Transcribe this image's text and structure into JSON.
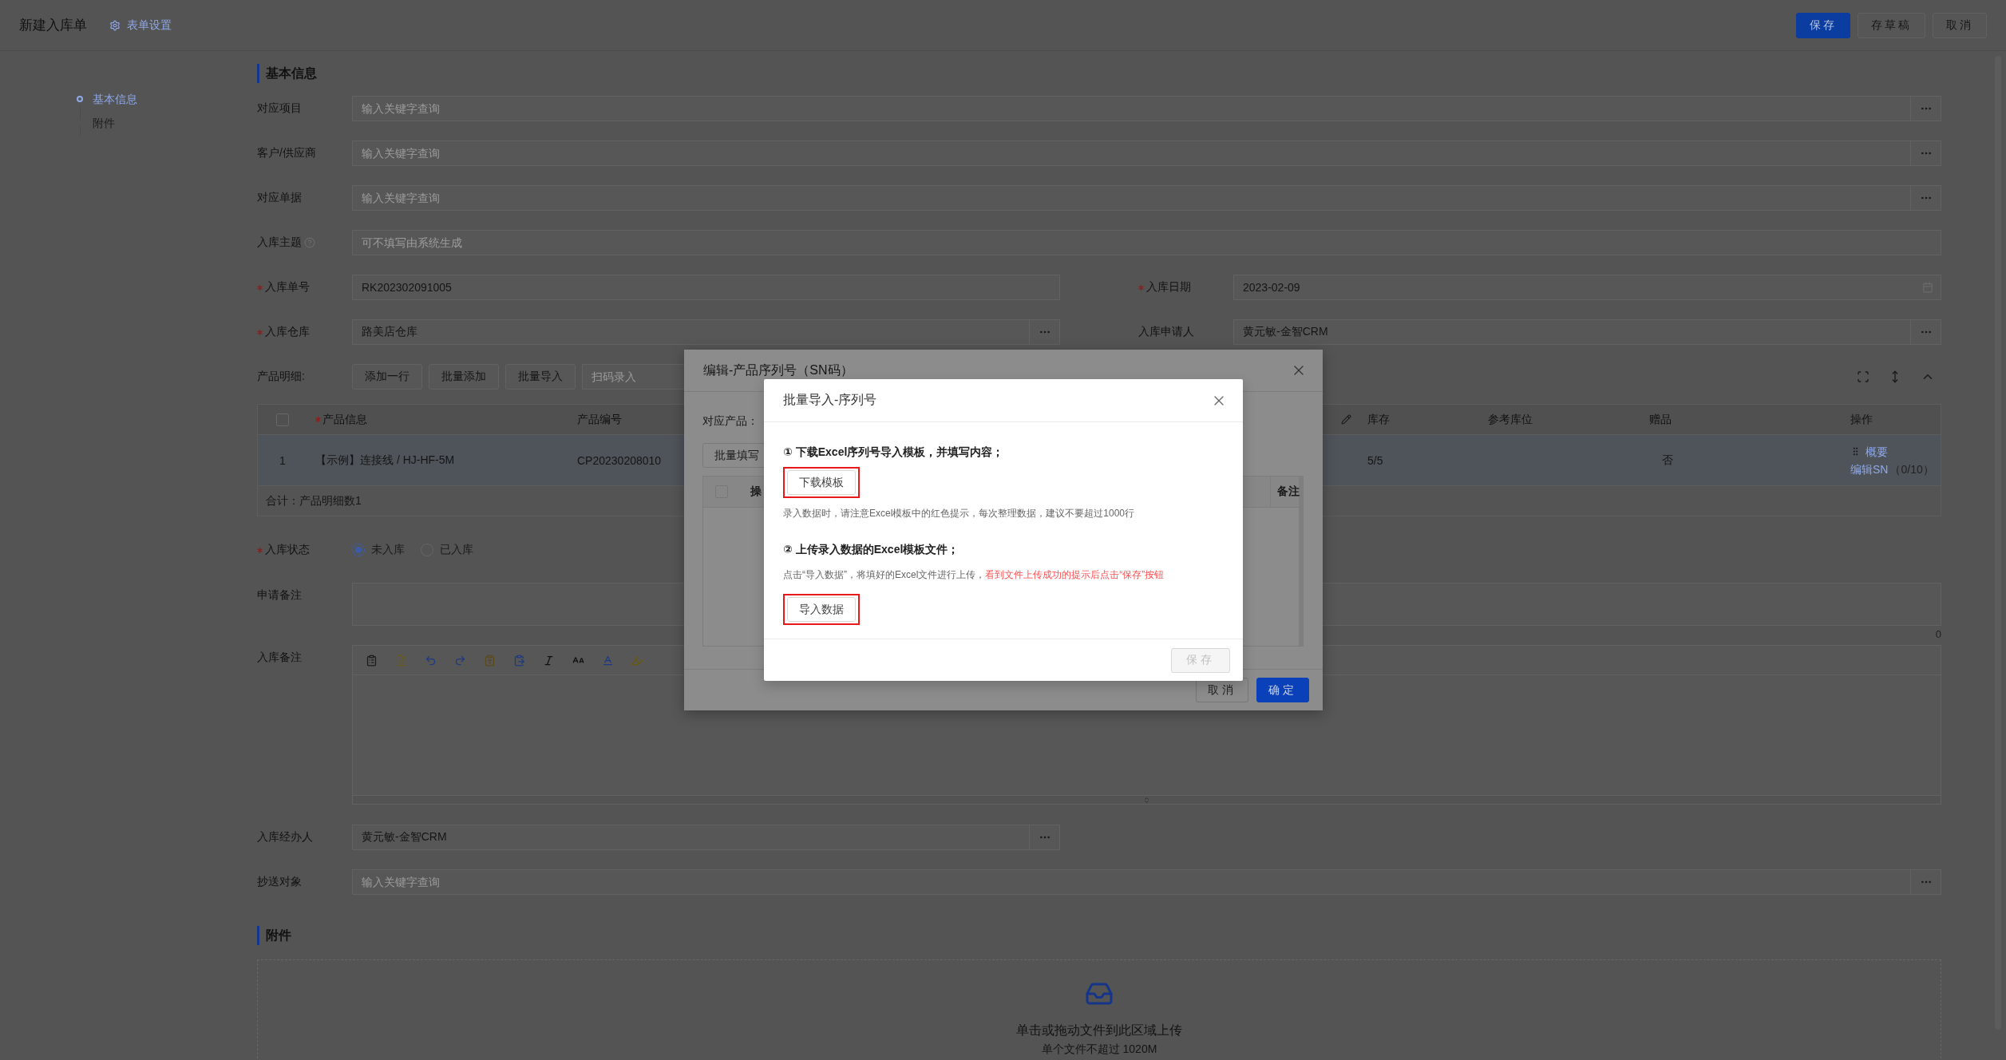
{
  "header": {
    "title": "新建入库单",
    "settings_link": "表单设置",
    "buttons": [
      {
        "label": "保存",
        "kind": "primary"
      },
      {
        "label": "存草稿",
        "kind": "default"
      },
      {
        "label": "取消",
        "kind": "default"
      }
    ]
  },
  "side_nav": [
    {
      "label": "基本信息",
      "selected": true
    },
    {
      "label": "附件",
      "selected": false
    }
  ],
  "basic_info": {
    "heading": "基本信息",
    "rows": [
      [
        {
          "label": "对应项目",
          "required": false,
          "help": false,
          "kind": "lookup",
          "placeholder": "输入关键字查询"
        }
      ],
      [
        {
          "label": "客户/供应商",
          "required": false,
          "help": false,
          "kind": "lookup",
          "placeholder": "输入关键字查询"
        }
      ],
      [
        {
          "label": "对应单据",
          "required": false,
          "help": false,
          "kind": "lookup",
          "placeholder": "输入关键字查询"
        }
      ],
      [
        {
          "label": "入库主题",
          "required": false,
          "help": true,
          "kind": "text",
          "placeholder": "可不填写由系统生成"
        }
      ],
      [
        {
          "label": "入库单号",
          "required": true,
          "help": false,
          "kind": "text",
          "value": "RK202302091005"
        },
        {
          "label": "入库日期",
          "required": true,
          "help": false,
          "kind": "date",
          "value": "2023-02-09"
        }
      ],
      [
        {
          "label": "入库仓库",
          "required": true,
          "help": false,
          "kind": "lookup",
          "value": "路美店仓库"
        },
        {
          "label": "入库申请人",
          "required": false,
          "help": false,
          "kind": "lookup",
          "value": "黄元敏-金智CRM"
        }
      ]
    ]
  },
  "products": {
    "label": "产品明细:",
    "buttons": [
      "添加一行",
      "批量添加",
      "批量导入"
    ],
    "scan_placeholder": "扫码录入",
    "columns": [
      {
        "kind": "checkbox",
        "checked": false
      },
      {
        "kind": "text",
        "label": "产品信息",
        "required": true
      },
      {
        "kind": "text",
        "label": "产品编号",
        "required": false
      },
      {
        "kind": "editable"
      },
      {
        "kind": "text",
        "label": "库存",
        "required": false
      },
      {
        "kind": "text",
        "label": "参考库位",
        "required": false
      },
      {
        "kind": "text",
        "label": "赠品",
        "required": false
      },
      {
        "kind": "text",
        "label": "操作",
        "required": false
      }
    ],
    "rows": [
      {
        "index": "1",
        "product": "【示例】连接线 / HJ-HF-5M",
        "code": "CP20230208010",
        "stock": "5/5",
        "gift": "否",
        "summary_link": "概要",
        "sn_link": "编辑SN",
        "sn_count": "（0/10）"
      }
    ],
    "total": "合计：产品明细数1"
  },
  "status": {
    "label": "入库状态",
    "required": true,
    "options": [
      {
        "label": "未入库",
        "selected": true
      },
      {
        "label": "已入库",
        "selected": false
      }
    ]
  },
  "apply_note": {
    "label": "申请备注",
    "counter": "0"
  },
  "stock_note": {
    "label": "入库备注"
  },
  "lower_rows": [
    [
      {
        "label": "入库经办人",
        "required": false,
        "help": false,
        "kind": "lookup",
        "value": "黄元敏-金智CRM"
      }
    ],
    [
      {
        "label": "抄送对象",
        "required": false,
        "help": false,
        "kind": "lookup",
        "placeholder": "输入关键字查询"
      }
    ]
  ],
  "attachments": {
    "heading": "附件",
    "upload_text": "单击或拖动文件到此区域上传",
    "upload_hint": "单个文件不超过 1020M"
  },
  "sn_dialog": {
    "title": "编辑-产品序列号（SN码）",
    "product_label": "对应产品：",
    "batch_button": "批量填写",
    "header_checkbox": {
      "checked": false
    },
    "columns": [
      "操",
      "备注"
    ],
    "buttons": [
      {
        "label": "取消",
        "kind": "default"
      },
      {
        "label": "确定",
        "kind": "primary"
      }
    ]
  },
  "import_dialog": {
    "title": "批量导入-序列号",
    "content": [
      {
        "kind": "heading",
        "text": "① 下载Excel序列号导入模板，并填写内容；"
      },
      {
        "kind": "button",
        "label": "下载模板",
        "highlighted": true
      },
      {
        "kind": "hint",
        "text": "录入数据时，请注意Excel模板中的红色提示，每次整理数据，建议不要超过1000行"
      },
      {
        "kind": "heading",
        "text": "② 上传录入数据的Excel模板文件；"
      },
      {
        "kind": "hint",
        "text": "点击“导入数据”，将填好的Excel文件进行上传，",
        "alert": "看到文件上传成功的提示后点击“保存”按钮"
      },
      {
        "kind": "button",
        "label": "导入数据",
        "highlighted": true
      }
    ],
    "save_button": {
      "label": "保存",
      "disabled": true
    }
  }
}
